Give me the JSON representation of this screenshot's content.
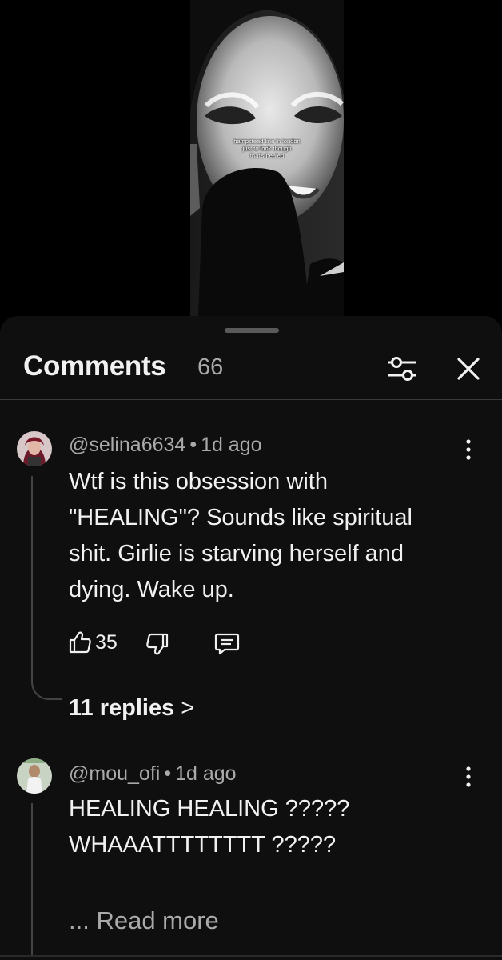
{
  "video": {
    "caption_lines": [
      "hampstead line in london",
      "just to look though",
      "that's healed"
    ]
  },
  "comments_panel": {
    "title": "Comments",
    "count": "66",
    "icons": {
      "filter": "sliders-icon",
      "close": "close-icon"
    }
  },
  "comments": [
    {
      "author": "@selina6634",
      "separator": "•",
      "time": "1d ago",
      "text_lines": [
        "Wtf is this obsession with",
        "\"HEALING\"? Sounds like spiritual",
        "shit. Girlie is starving herself and",
        "dying. Wake up."
      ],
      "likes": "35",
      "replies_label": "11 replies",
      "replies_chevron": ">"
    },
    {
      "author": "@mou_ofi",
      "separator": "•",
      "time": "1d ago",
      "text_lines": [
        "HEALING HEALING ?????",
        "WHAAATTTTTTTT ?????"
      ],
      "read_more": "... Read more"
    }
  ],
  "colors": {
    "sheet_bg": "#0f0f0f",
    "text_primary": "#f1f1f1",
    "text_secondary": "#aaaaaa",
    "divider": "#3a3a3a"
  }
}
